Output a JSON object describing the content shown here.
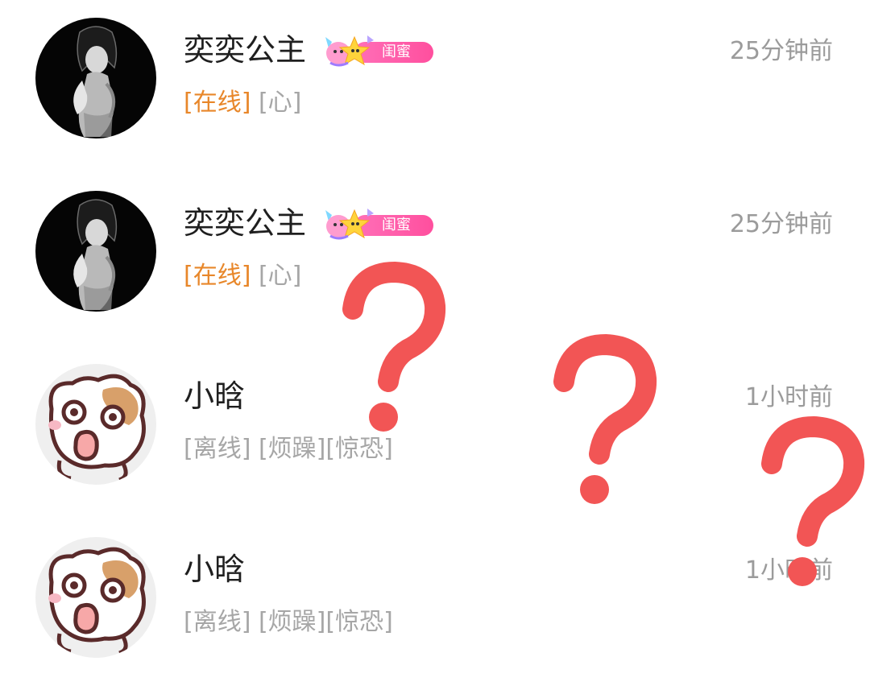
{
  "contacts": [
    {
      "name": "奕奕公主",
      "time": "25分钟前",
      "badge": {
        "label": "闺蜜"
      },
      "status": [
        {
          "text": "[在线]",
          "tone": "online"
        },
        {
          "text": "[心]",
          "tone": "gray"
        }
      ],
      "avatar": "dark-anime-girl"
    },
    {
      "name": "奕奕公主",
      "time": "25分钟前",
      "badge": {
        "label": "闺蜜"
      },
      "status": [
        {
          "text": "[在线]",
          "tone": "online"
        },
        {
          "text": "[心]",
          "tone": "gray"
        }
      ],
      "avatar": "dark-anime-girl"
    },
    {
      "name": "小晗",
      "time": "1小时前",
      "status": [
        {
          "text": "[离线]",
          "tone": "gray"
        },
        {
          "text": "[烦躁][惊恐]",
          "tone": "gray"
        }
      ],
      "avatar": "surprised-cartoon-cat"
    },
    {
      "name": "小晗",
      "time": "1小时前",
      "status": [
        {
          "text": "[离线]",
          "tone": "gray"
        },
        {
          "text": "[烦躁][惊恐]",
          "tone": "gray"
        }
      ],
      "avatar": "surprised-cartoon-cat"
    }
  ],
  "overlay": {
    "question_marks": [
      "?",
      "?",
      "?"
    ],
    "color": "#f25555"
  },
  "colors": {
    "online": "#e8872a",
    "gray": "#a6a6a6",
    "name": "#1f1f1f",
    "time": "#9b9b9b",
    "badge": "#ff4f9e"
  }
}
